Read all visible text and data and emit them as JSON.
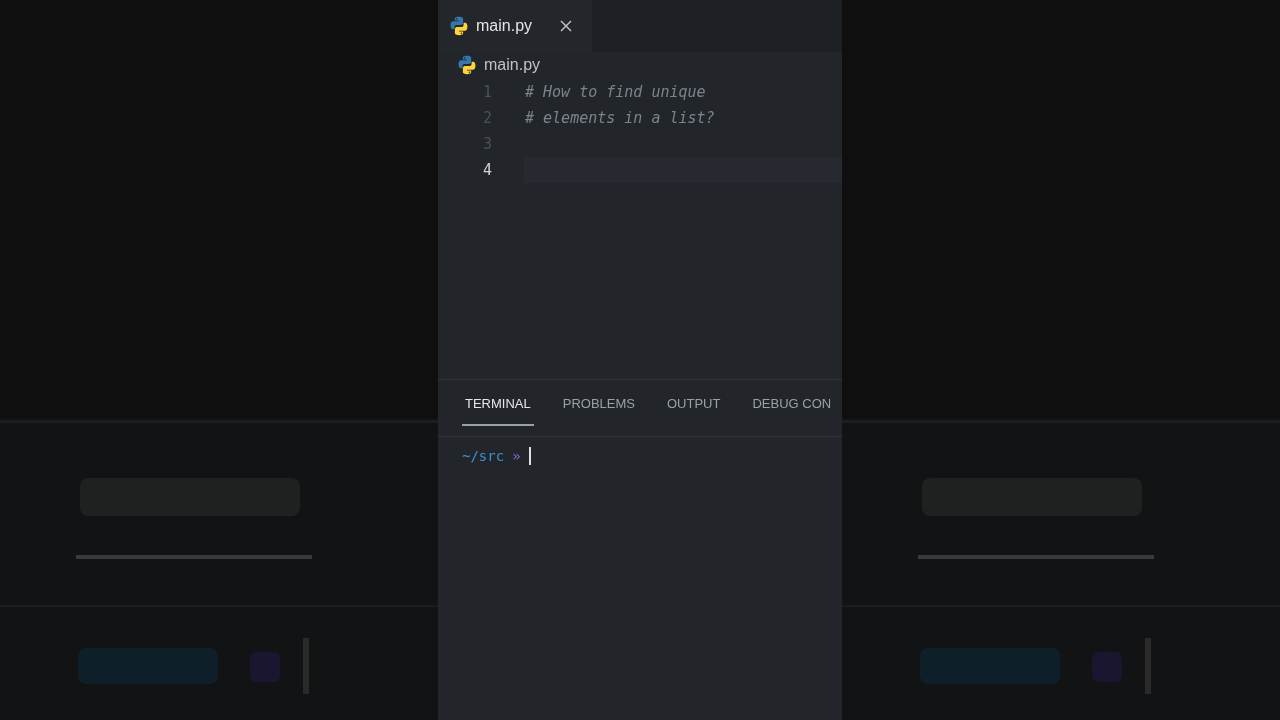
{
  "editor_tabs": [
    {
      "label": "main.py",
      "selected": true
    }
  ],
  "breadcrumb": {
    "label": "main.py"
  },
  "code_lines": [
    {
      "number": "1",
      "text": "# How to find unique",
      "current": false
    },
    {
      "number": "2",
      "text": "# elements in a list?",
      "current": false
    },
    {
      "number": "3",
      "current": false
    },
    {
      "number": "4",
      "current": true
    }
  ],
  "panel_tabs": [
    {
      "label": "TERMINAL",
      "selected": true
    },
    {
      "label": "PROBLEMS",
      "selected": false
    },
    {
      "label": "OUTPUT",
      "selected": false
    },
    {
      "label": "DEBUG CON",
      "selected": false
    }
  ],
  "terminal": {
    "path": "~/src",
    "prompt": "»",
    "cursor": true
  }
}
